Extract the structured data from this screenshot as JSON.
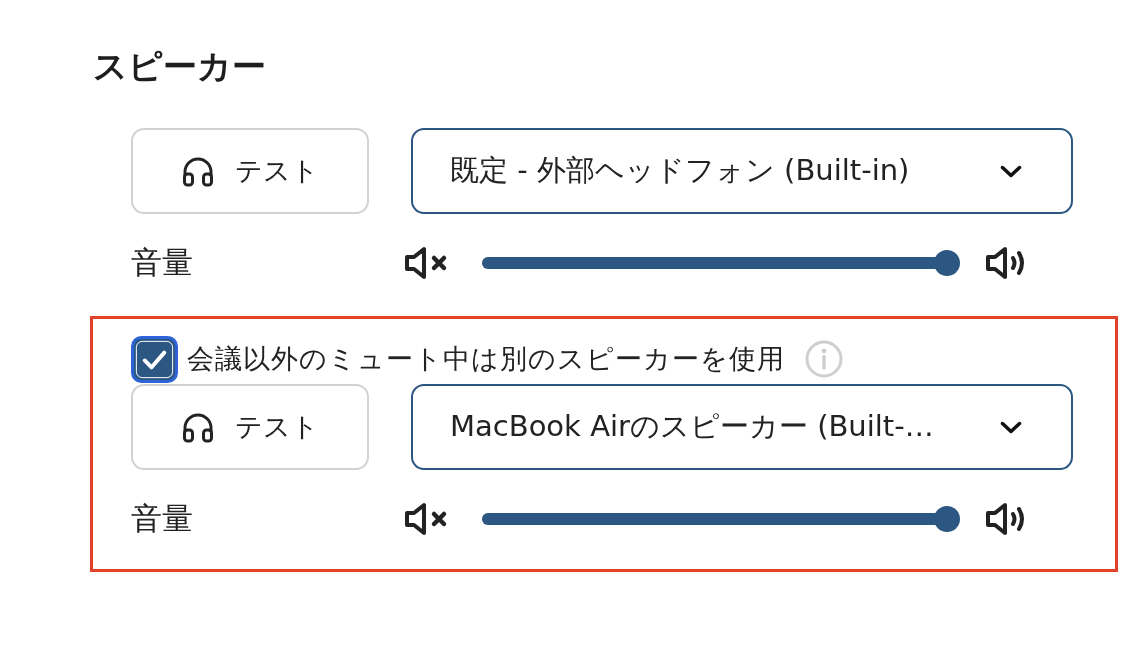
{
  "title": "スピーカー",
  "outputs": [
    {
      "highlighted": false,
      "test_button": {
        "label": "テスト"
      },
      "device_select": {
        "value": "既定 - 外部ヘッドフォン (Built-in)"
      },
      "volume": {
        "label": "音量",
        "level": 1
      }
    },
    {
      "highlighted": true,
      "checkbox": {
        "label": "会議以外のミュート中は別のスピーカーを使用",
        "checked": true
      },
      "test_button": {
        "label": "テスト"
      },
      "device_select": {
        "value": "MacBook Airのスピーカー (Built-…"
      },
      "volume": {
        "label": "音量",
        "level": 1
      }
    }
  ]
}
